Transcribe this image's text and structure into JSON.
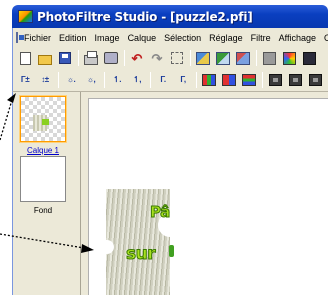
{
  "window": {
    "title": "PhotoFiltre Studio - [puzzle2.pfi]"
  },
  "menu": {
    "items": [
      "Fichier",
      "Edition",
      "Image",
      "Calque",
      "Sélection",
      "Réglage",
      "Filtre",
      "Affichage",
      "O"
    ]
  },
  "toolbar1": {
    "icons": [
      "new-file-icon",
      "open-folder-icon",
      "save-icon",
      "print-icon",
      "scanner-icon",
      "undo-icon",
      "redo-icon",
      "select-icon",
      "layer-icon",
      "layer-add-icon",
      "layer-image-icon",
      "grayscale-icon",
      "color-icon",
      "dark-icon"
    ]
  },
  "toolbar2": {
    "labels": [
      "T:",
      "t:",
      "⌗",
      "⌗",
      "",
      "",
      "Γ",
      "Γ"
    ]
  },
  "layers": {
    "items": [
      {
        "label": "Calque 1",
        "selected": true
      },
      {
        "label": "Fond",
        "selected": false
      }
    ]
  },
  "canvas": {
    "piece_text_top": "Pâ",
    "piece_text_bottom": "sur"
  },
  "colors": {
    "titlebar": "#0a3fc0",
    "chrome": "#ece9d8",
    "text_fill": "#a8e020",
    "text_stroke": "#3a7a00",
    "annotation": "#000000"
  }
}
